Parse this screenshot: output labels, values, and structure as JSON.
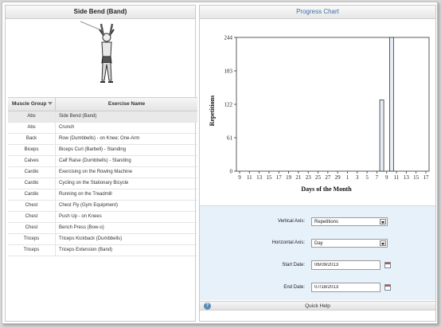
{
  "left_panel": {
    "title": "Side Bend (Band)",
    "columns": {
      "muscle_group": "Muscle Group",
      "exercise_name": "Exercise Name"
    },
    "rows": [
      {
        "group": "Abs",
        "exercise": "Side Bend (Band)",
        "selected": true
      },
      {
        "group": "Abs",
        "exercise": "Crunch"
      },
      {
        "group": "Back",
        "exercise": "Row (Dumbbells) - on Knee; One-Arm"
      },
      {
        "group": "Biceps",
        "exercise": "Biceps Curl (Barbell) - Standing"
      },
      {
        "group": "Calves",
        "exercise": "Calf Raise (Dumbbells) - Standing"
      },
      {
        "group": "Cardio",
        "exercise": "Exercising on the Rowing Machine"
      },
      {
        "group": "Cardio",
        "exercise": "Cycling on the Stationary Bicycle"
      },
      {
        "group": "Cardio",
        "exercise": "Running on the Treadmill"
      },
      {
        "group": "Chest",
        "exercise": "Chest Fly (Gym Equipment)"
      },
      {
        "group": "Chest",
        "exercise": "Push Up - on Knees"
      },
      {
        "group": "Chest",
        "exercise": "Bench Press (Bow-o)"
      },
      {
        "group": "Triceps",
        "exercise": "Triceps Kickback (Dumbbells)"
      },
      {
        "group": "Triceps",
        "exercise": "Triceps Extension (Band)"
      }
    ]
  },
  "right_panel": {
    "title": "Progress Chart",
    "form": {
      "vertical_axis_label": "Vertical Axis:",
      "vertical_axis_value": "Repetitions",
      "horizontal_axis_label": "Horizontal Axis:",
      "horizontal_axis_value": "Day",
      "start_date_label": "Start Date:",
      "start_date_value": "06/09/2013",
      "end_date_label": "End Date:",
      "end_date_value": "07/18/2013"
    },
    "quick_help": "Quick Help",
    "quick_help_icon": "?"
  },
  "chart_data": {
    "type": "bar",
    "xlabel": "Days of the Month",
    "ylabel": "Repetitions",
    "ylim": [
      0,
      244
    ],
    "yticks": [
      0,
      61,
      122,
      183,
      244
    ],
    "xticks": [
      "9",
      "11",
      "13",
      "15",
      "17",
      "19",
      "21",
      "23",
      "25",
      "27",
      "29",
      "1",
      "3",
      "5",
      "7",
      "9",
      "11",
      "13",
      "15",
      "17"
    ],
    "bars": [
      {
        "x": "8",
        "value": 130
      },
      {
        "x": "10",
        "value": 244
      }
    ],
    "colors": {
      "bar_fill": "#e8eef6",
      "bar_stroke": "#333333"
    }
  }
}
